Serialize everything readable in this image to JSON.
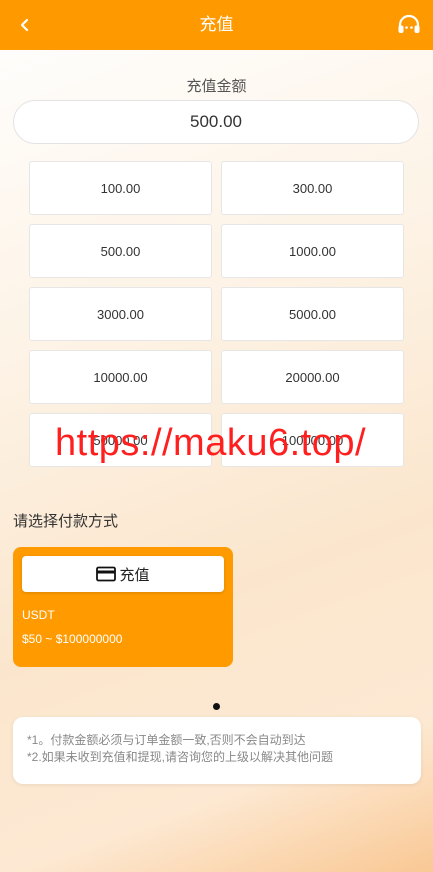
{
  "header": {
    "title": "充值",
    "back_icon": "chevron-left-icon",
    "support_icon": "headset-icon",
    "bg_color": "#ff9900"
  },
  "amount": {
    "label": "充值金额",
    "value": "500.00"
  },
  "presets": [
    "100.00",
    "300.00",
    "500.00",
    "1000.00",
    "3000.00",
    "5000.00",
    "10000.00",
    "20000.00",
    "50000.00",
    "100000.00"
  ],
  "watermark": "https://maku6.top/",
  "payment": {
    "label": "请选择付款方式",
    "methods": [
      {
        "button_label": "充值",
        "icon": "credit-card-icon",
        "name": "USDT",
        "range": "$50 ~ $100000000",
        "color": "#ff9b00"
      }
    ]
  },
  "notes": [
    "*1。付款金额必须与订单金额一致,否则不会自动到达",
    "*2.如果未收到充值和提现,请咨询您的上级以解决其他问题"
  ]
}
